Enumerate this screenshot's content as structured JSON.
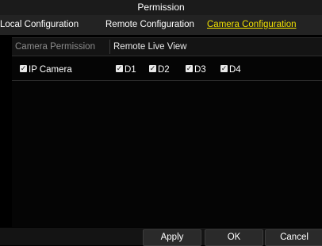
{
  "window": {
    "title": "Permission"
  },
  "tabs": [
    {
      "label": "Local Configuration"
    },
    {
      "label": "Remote Configuration"
    },
    {
      "label": "Camera Configuration",
      "active": true
    }
  ],
  "permission": {
    "label": "Camera Permission",
    "value": "Remote Live View"
  },
  "camera_row": {
    "group": {
      "label": "IP Camera",
      "checked": true
    },
    "channels": [
      {
        "label": "D1",
        "checked": true
      },
      {
        "label": "D2",
        "checked": true
      },
      {
        "label": "D3",
        "checked": true
      },
      {
        "label": "D4",
        "checked": true
      }
    ]
  },
  "buttons": {
    "apply": "Apply",
    "ok": "OK",
    "cancel": "Cancel"
  },
  "colors": {
    "active_tab": "#f0e000",
    "background": "#000000"
  },
  "icons": {
    "checkbox": "checkbox-checked-icon"
  }
}
